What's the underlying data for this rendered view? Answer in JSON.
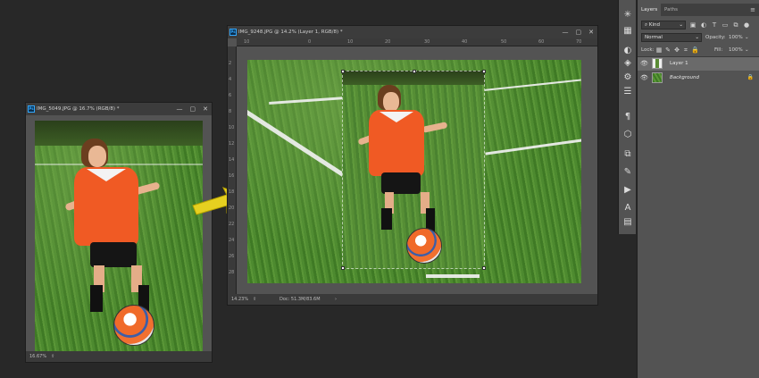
{
  "left_doc": {
    "title": "IMG_5049.JPG @ 16.7% (RGB/8) *",
    "zoom": "16.67%"
  },
  "main_doc": {
    "title": "IMG_9248.JPG @ 14.2% (Layer 1, RGB/8) *",
    "zoom": "14.23%",
    "doc_size": "Doc: 51.3M/83.6M",
    "ruler_top": [
      "10",
      "0",
      "10",
      "20",
      "30",
      "40",
      "50",
      "60",
      "70"
    ],
    "ruler_left": [
      "2",
      "4",
      "6",
      "8",
      "10",
      "12",
      "14",
      "16",
      "18",
      "20",
      "22",
      "24",
      "26",
      "28"
    ]
  },
  "window_controls": {
    "minimize": "—",
    "maximize": "▢",
    "close": "✕"
  },
  "layers_panel": {
    "tabs": [
      "Layers",
      "Paths"
    ],
    "filter_label": "Kind",
    "blend_mode": "Normal",
    "opacity_label": "Opacity:",
    "opacity_value": "100%",
    "lock_label": "Lock:",
    "fill_label": "Fill:",
    "fill_value": "100%",
    "layers": [
      {
        "name": "Layer 1",
        "visible": true,
        "selected": true
      },
      {
        "name": "Background",
        "visible": true,
        "selected": false,
        "locked": true
      }
    ]
  },
  "toolbar_icons": [
    "asterisk-icon",
    "swatches-icon",
    "paragraph-icon",
    "cube-icon",
    "layers-icon",
    "channels-icon",
    "actions-icon",
    "clone-icon",
    "play-icon",
    "text-icon",
    "grid-icon"
  ],
  "colors": {
    "workspace": "#282828",
    "panel": "#535353",
    "jersey_orange": "#f05a24",
    "arrow_yellow": "#e6d020"
  }
}
